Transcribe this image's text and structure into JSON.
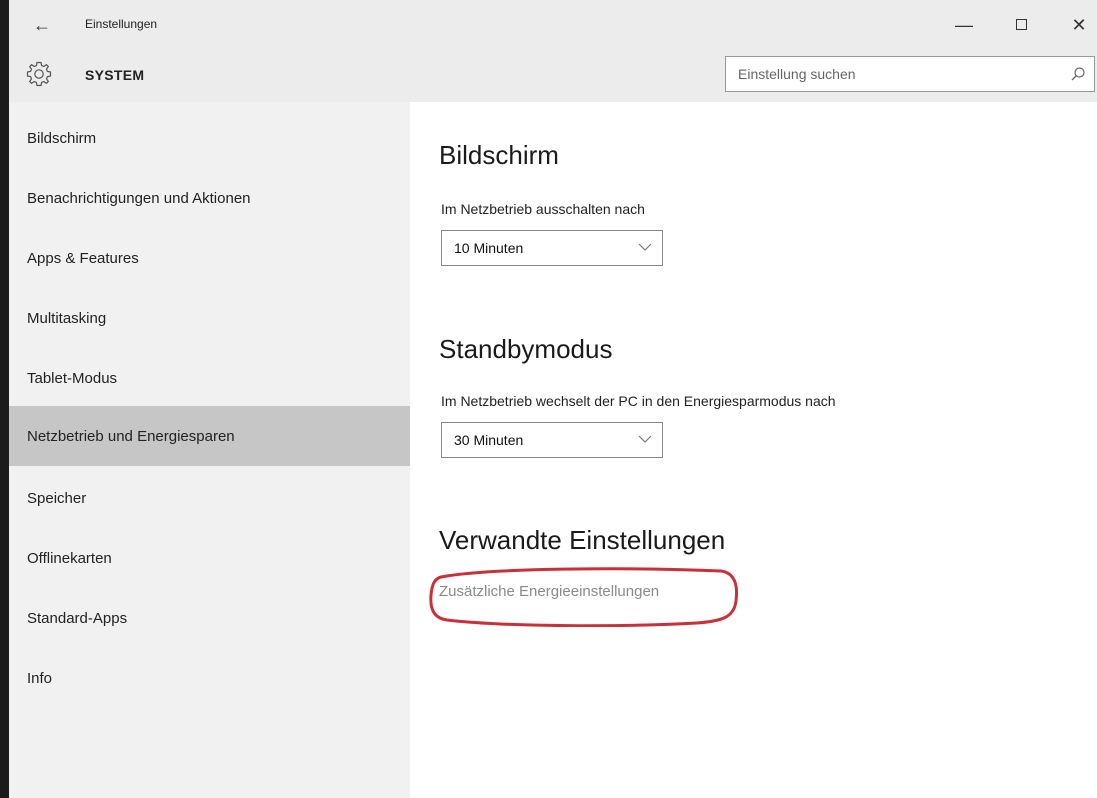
{
  "window": {
    "title": "Einstellungen",
    "back_glyph": "←",
    "minimize_glyph": "—",
    "close_glyph": "✕"
  },
  "header": {
    "title": "SYSTEM",
    "icon": "gear-icon",
    "search_placeholder": "Einstellung suchen"
  },
  "sidebar": {
    "items": [
      {
        "label": "Bildschirm",
        "selected": false
      },
      {
        "label": "Benachrichtigungen und Aktionen",
        "selected": false
      },
      {
        "label": "Apps & Features",
        "selected": false
      },
      {
        "label": "Multitasking",
        "selected": false
      },
      {
        "label": "Tablet-Modus",
        "selected": false
      },
      {
        "label": "Netzbetrieb und Energiesparen",
        "selected": true
      },
      {
        "label": "Speicher",
        "selected": false
      },
      {
        "label": "Offlinekarten",
        "selected": false
      },
      {
        "label": "Standard-Apps",
        "selected": false
      },
      {
        "label": "Info",
        "selected": false
      }
    ]
  },
  "main": {
    "screen": {
      "title": "Bildschirm",
      "label": "Im Netzbetrieb ausschalten nach",
      "value": "10 Minuten"
    },
    "standby": {
      "title": "Standbymodus",
      "label": "Im Netzbetrieb wechselt der PC in den Energiesparmodus nach",
      "value": "30 Minuten"
    },
    "related": {
      "title": "Verwandte Einstellungen",
      "link": "Zusätzliche Energieeinstellungen"
    }
  },
  "colors": {
    "selected_bg": "#c6c6c6",
    "sidebar_bg": "#f1f1f1",
    "titlebar_bg": "#ececec",
    "link_color": "#8a8a8a",
    "highlight": "#c8303a"
  }
}
